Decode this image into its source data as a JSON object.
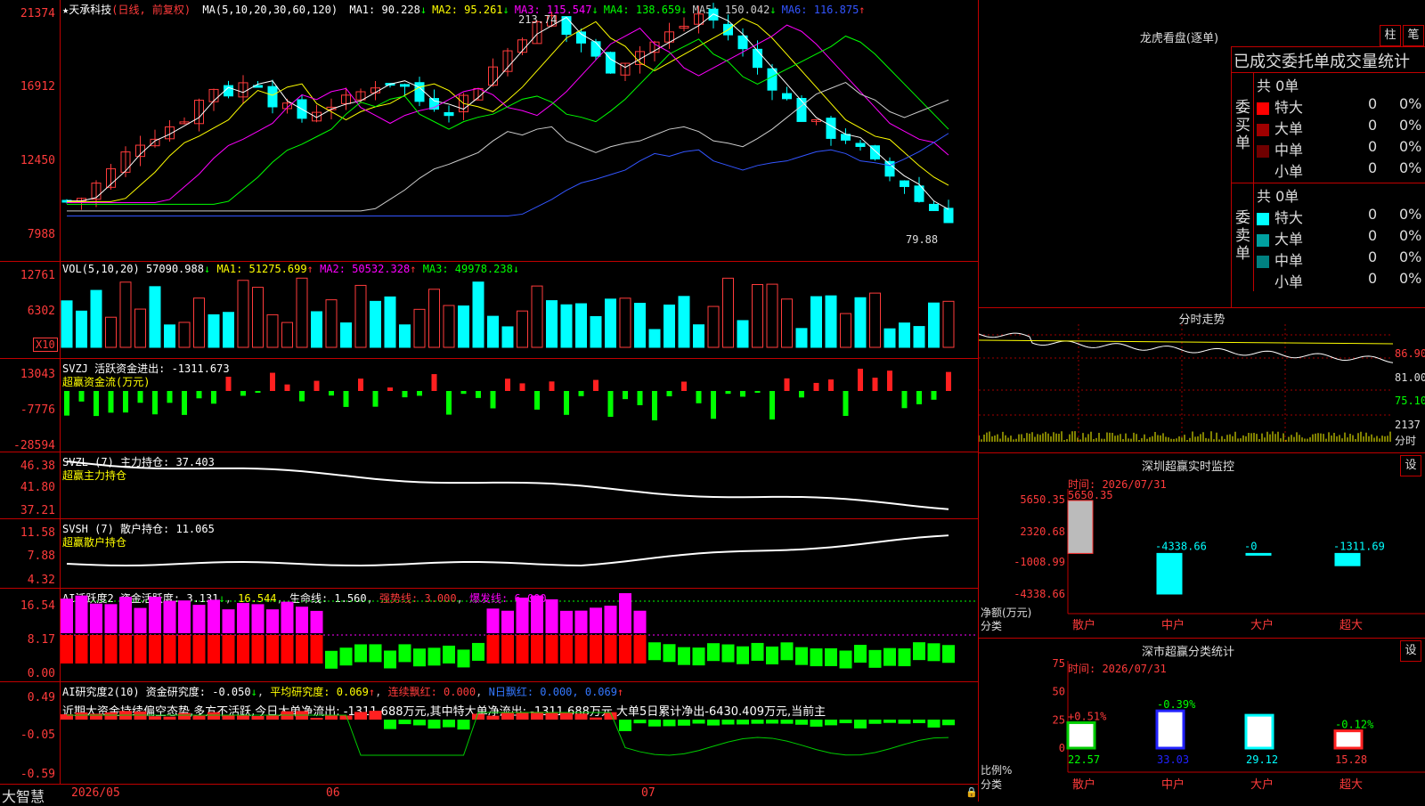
{
  "stock": {
    "name": "天承科技",
    "mode": "(日线, 前复权)"
  },
  "main": {
    "ma_label": "MA(5,10,20,30,60,120)",
    "ma": [
      {
        "k": "MA1:",
        "v": "90.228",
        "c": "#ffffff"
      },
      {
        "k": "MA2:",
        "v": "95.261",
        "c": "#ffff00"
      },
      {
        "k": "MA3:",
        "v": "115.547",
        "c": "#ff00ff"
      },
      {
        "k": "MA4:",
        "v": "138.659",
        "c": "#00ff00"
      },
      {
        "k": "MA5:",
        "v": "150.042",
        "c": "#cccccc"
      },
      {
        "k": "MA6:",
        "v": "116.875",
        "c": "#3355ff"
      }
    ],
    "yticks": [
      "21374",
      "16912",
      "12450",
      "7988"
    ],
    "high_label": "213.74",
    "low_label": "79.88"
  },
  "vol": {
    "label": "VOL(5,10,20)",
    "val": "57090.988",
    "ma1": "MA1: 51275.699",
    "ma2": "MA2: 50532.328",
    "ma3": "MA3: 49978.238",
    "yticks": [
      "12761",
      "6302"
    ],
    "unit": "X10"
  },
  "svzj": {
    "label": "SVZJ  活跃资金进出: -1311.673",
    "sub": "超赢资金流(万元)",
    "yticks": [
      "13043",
      "-7776",
      "-28594"
    ]
  },
  "svzl": {
    "label": "SVZL (7) 主力持仓: 37.403",
    "sub": "超赢主力持仓",
    "yticks": [
      "46.38",
      "41.80",
      "37.21"
    ]
  },
  "svsh": {
    "label": "SVSH (7) 散户持仓: 11.065",
    "sub": "超赢散户持仓",
    "yticks": [
      "11.58",
      "7.88",
      "4.32"
    ]
  },
  "ai2": {
    "label": "AI活跃度2 资金活跃度: 3.131",
    "v2": "16.544",
    "v3": "生命线: 1.560",
    "v4": "强势线: 3.000",
    "v5": "爆发线: 6.000",
    "yticks": [
      "16.54",
      "8.17",
      "0.00"
    ]
  },
  "ai_research": {
    "label": "AI研究度2(10) 资金研究度: -0.050",
    "v2": "平均研究度: 0.069",
    "v3": "连续飘红: 0.000",
    "v4": "N日飘红: 0.000, 0.069",
    "yticks": [
      "0.49",
      "-0.05",
      "-0.59"
    ],
    "comment": "近期大资金持续偏空态势,多方不活跃,今日大单净流出: -1311.688万元,其中特大单净流出: -1311.688万元,大单5日累计净出-6430.409万元,当前主"
  },
  "footer": {
    "brand": "大智慧",
    "dates": [
      "2026/05",
      "06",
      "07"
    ]
  },
  "lhb": {
    "title": "龙虎看盘(逐单)",
    "btn1": "柱",
    "btn2": "笔",
    "head": "已成交委托单成交量统计",
    "buy": {
      "side": "委买单",
      "total": "共 0单",
      "rows": [
        {
          "n": "特大",
          "q": "0",
          "p": "0%",
          "c": "#ff0000"
        },
        {
          "n": "大单",
          "q": "0",
          "p": "0%",
          "c": "#a00000"
        },
        {
          "n": "中单",
          "q": "0",
          "p": "0%",
          "c": "#700000"
        },
        {
          "n": "小单",
          "q": "0",
          "p": "0%",
          "c": "#000000"
        }
      ]
    },
    "sell": {
      "side": "委卖单",
      "total": "共 0单",
      "rows": [
        {
          "n": "特大",
          "q": "0",
          "p": "0%",
          "c": "#00ffff"
        },
        {
          "n": "大单",
          "q": "0",
          "p": "0%",
          "c": "#00a0a0"
        },
        {
          "n": "中单",
          "q": "0",
          "p": "0%",
          "c": "#008080"
        },
        {
          "n": "小单",
          "q": "0",
          "p": "0%",
          "c": "#000000"
        }
      ]
    }
  },
  "intraday": {
    "title": "分时走势",
    "yticks": [
      "86.90",
      "81.00",
      "75.10",
      "2137",
      "分时"
    ]
  },
  "monitor": {
    "title": "深圳超赢实时监控",
    "btn": "设",
    "time": "时间: 2026/07/31",
    "yticks": [
      "5650.35",
      "2320.68",
      "-1008.99",
      "-4338.66"
    ],
    "ylabel": "净额(万元)",
    "xlabel": "分类",
    "bars": [
      {
        "cat": "散户",
        "v": 5650.35,
        "lab": "5650.35"
      },
      {
        "cat": "中户",
        "v": -4338.66,
        "lab": "-4338.66"
      },
      {
        "cat": "大户",
        "v": -0.0,
        "lab": "-0"
      },
      {
        "cat": "超大",
        "v": -1311.69,
        "lab": "-1311.69"
      }
    ]
  },
  "classify": {
    "title": "深市超赢分类统计",
    "btn": "设",
    "time": "时间: 2026/07/31",
    "yticks": [
      "75",
      "50",
      "25",
      "0"
    ],
    "ylabel": "比例%",
    "xlabel": "分类",
    "bars": [
      {
        "cat": "散户",
        "v": 22.57,
        "lab": "22.57",
        "d": "+0.51%"
      },
      {
        "cat": "中户",
        "v": 33.03,
        "lab": "33.03",
        "d": "-0.39%"
      },
      {
        "cat": "大户",
        "v": 29.12,
        "lab": "29.12",
        "d": ""
      },
      {
        "cat": "超大",
        "v": 15.28,
        "lab": "15.28",
        "d": "-0.12%"
      }
    ]
  }
}
